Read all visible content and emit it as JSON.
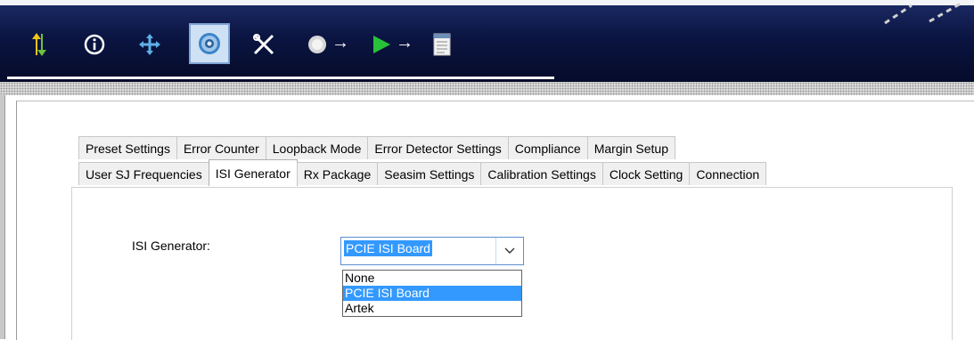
{
  "toolbar": {
    "icons": [
      {
        "name": "transfer-arrows-icon"
      },
      {
        "name": "info-icon"
      },
      {
        "name": "move-icon"
      },
      {
        "name": "settings-gear-icon",
        "active": true
      },
      {
        "name": "tools-icon"
      },
      {
        "name": "power-icon"
      },
      {
        "name": "run-play-icon"
      },
      {
        "name": "report-document-icon"
      }
    ]
  },
  "tabs": {
    "row1": [
      "Preset Settings",
      "Error Counter",
      "Loopback Mode",
      "Error Detector Settings",
      "Compliance",
      "Margin Setup"
    ],
    "row2": [
      "User SJ Frequencies",
      "ISI Generator",
      "Rx Package",
      "Seasim Settings",
      "Calibration Settings",
      "Clock Setting",
      "Connection"
    ],
    "selected": "ISI Generator"
  },
  "isi": {
    "label": "ISI Generator:",
    "selected": "PCIE ISI Board",
    "options": [
      "None",
      "PCIE ISI Board",
      "Artek"
    ],
    "highlighted_index": 1
  },
  "colors": {
    "toolbar_bg": "#0b1542",
    "selection": "#3399ff",
    "combo_border": "#5b8fd0"
  }
}
